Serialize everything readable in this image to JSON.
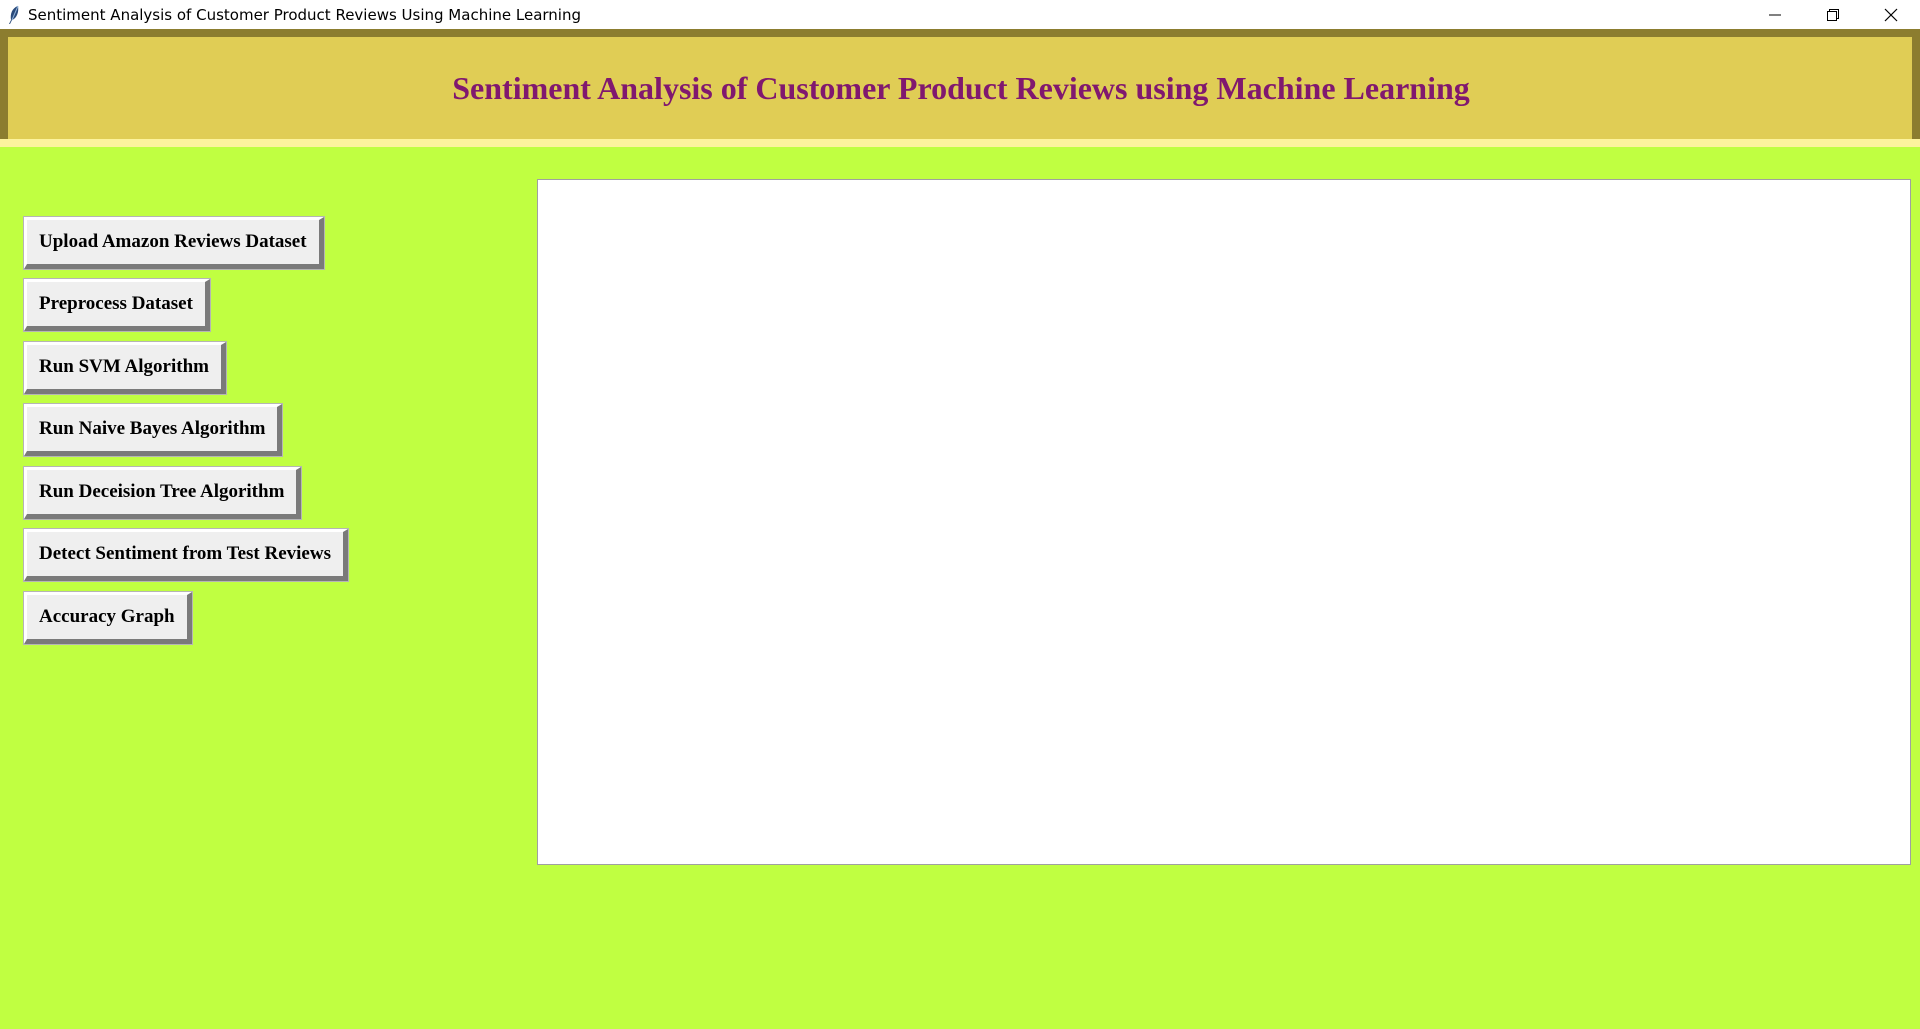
{
  "window": {
    "title": "Sentiment Analysis of Customer Product Reviews Using Machine Learning"
  },
  "header": {
    "title": "Sentiment Analysis of Customer Product Reviews using Machine Learning"
  },
  "buttons": {
    "upload": "Upload Amazon Reviews Dataset",
    "preprocess": "Preprocess Dataset",
    "svm": "Run SVM Algorithm",
    "naive_bayes": "Run Naive Bayes Algorithm",
    "decision_tree": "Run Deceision Tree Algorithm",
    "detect": "Detect Sentiment from Test Reviews",
    "graph": "Accuracy Graph"
  },
  "output": {
    "text": ""
  },
  "colors": {
    "background": "#c0ff41",
    "banner": "#e0cd55",
    "banner_text": "#80186f",
    "button_face": "#efefef"
  },
  "icons": {
    "app": "feather-icon",
    "minimize": "minimize-icon",
    "restore": "restore-icon",
    "close": "close-icon"
  }
}
